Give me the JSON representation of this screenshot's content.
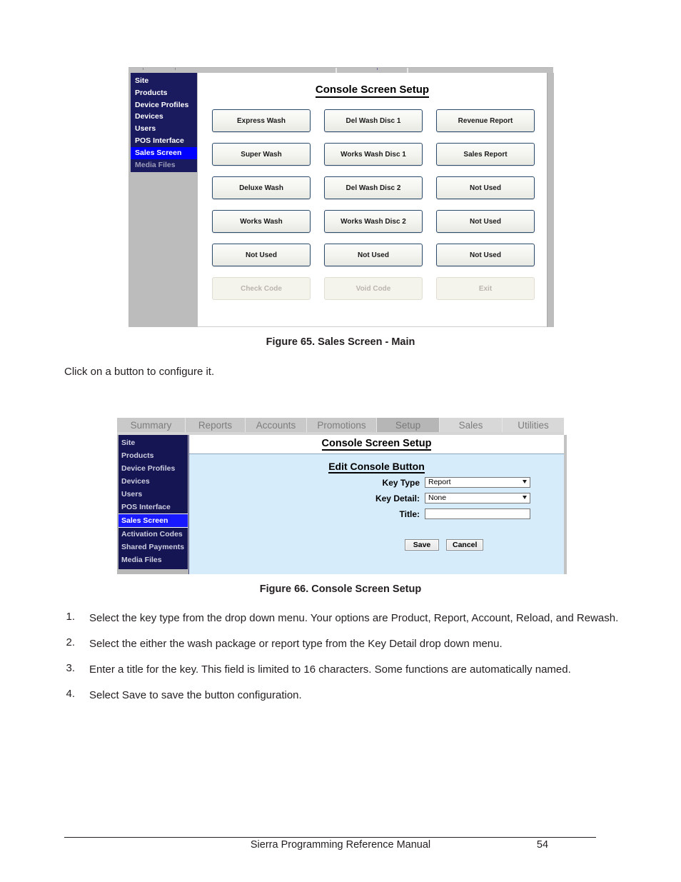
{
  "figure1": {
    "app_title": "Console Screen Setup",
    "sidebar": [
      {
        "label": "Site",
        "state": "normal"
      },
      {
        "label": "Products",
        "state": "normal"
      },
      {
        "label": "Device Profiles",
        "state": "normal"
      },
      {
        "label": "Devices",
        "state": "normal"
      },
      {
        "label": "Users",
        "state": "normal"
      },
      {
        "label": "POS Interface",
        "state": "normal"
      },
      {
        "label": "Sales Screen",
        "state": "selected"
      },
      {
        "label": "Media Files",
        "state": "dim"
      }
    ],
    "buttons": [
      {
        "label": "Express Wash",
        "state": "enabled"
      },
      {
        "label": "Del Wash Disc 1",
        "state": "enabled"
      },
      {
        "label": "Revenue Report",
        "state": "enabled"
      },
      {
        "label": "Super Wash",
        "state": "enabled"
      },
      {
        "label": "Works Wash Disc 1",
        "state": "enabled"
      },
      {
        "label": "Sales Report",
        "state": "enabled"
      },
      {
        "label": "Deluxe Wash",
        "state": "enabled"
      },
      {
        "label": "Del Wash Disc 2",
        "state": "enabled"
      },
      {
        "label": "Not Used",
        "state": "enabled"
      },
      {
        "label": "Works Wash",
        "state": "enabled"
      },
      {
        "label": "Works Wash Disc 2",
        "state": "enabled"
      },
      {
        "label": "Not Used",
        "state": "enabled"
      },
      {
        "label": "Not Used",
        "state": "enabled"
      },
      {
        "label": "Not Used",
        "state": "enabled"
      },
      {
        "label": "Not Used",
        "state": "enabled"
      },
      {
        "label": "Check Code",
        "state": "disabled"
      },
      {
        "label": "Void Code",
        "state": "disabled"
      },
      {
        "label": "Exit",
        "state": "disabled"
      }
    ],
    "caption": "Figure 65. Sales Screen - Main"
  },
  "intro_paragraph": "Click on a button to configure it.",
  "figure2": {
    "tabs": [
      {
        "label": "Summary",
        "active": false,
        "light": false
      },
      {
        "label": "Reports",
        "active": false,
        "light": false
      },
      {
        "label": "Accounts",
        "active": false,
        "light": false
      },
      {
        "label": "Promotions",
        "active": false,
        "light": false
      },
      {
        "label": "Setup",
        "active": true,
        "light": false
      },
      {
        "label": "Sales",
        "active": false,
        "light": true
      },
      {
        "label": "Utilities",
        "active": false,
        "light": true
      }
    ],
    "sidebar": [
      {
        "label": "Site",
        "state": "normal"
      },
      {
        "label": "Products",
        "state": "normal"
      },
      {
        "label": "Device Profiles",
        "state": "normal"
      },
      {
        "label": "Devices",
        "state": "normal"
      },
      {
        "label": "Users",
        "state": "normal"
      },
      {
        "label": "POS Interface",
        "state": "normal"
      },
      {
        "label": "Sales Screen",
        "state": "selected"
      },
      {
        "label": "Activation Codes",
        "state": "normal"
      },
      {
        "label": "Shared Payments",
        "state": "normal"
      },
      {
        "label": "Media Files",
        "state": "normal"
      }
    ],
    "page_header": "Console Screen Setup",
    "panel_title": "Edit Console Button",
    "form": {
      "key_type_label": "Key Type",
      "key_type_value": "Report",
      "key_detail_label": "Key Detail:",
      "key_detail_value": "None",
      "title_label": "Title:",
      "title_value": "",
      "title_placeholder": ""
    },
    "save_label": "Save",
    "cancel_label": "Cancel",
    "caption": "Figure 66. Console Screen Setup"
  },
  "steps": [
    {
      "num": "1.",
      "text": "Select the key type from the drop down menu. Your options are Product, Report, Account, Reload, and Rewash."
    },
    {
      "num": "2.",
      "text": "Select the either the wash package or report type from the Key Detail drop down menu."
    },
    {
      "num": "3.",
      "text": "Enter a title for the key. This field is limited to 16 characters. Some functions are automatically named."
    },
    {
      "num": "4.",
      "text": "Select Save to save the button configuration."
    }
  ],
  "footer": {
    "title": "Sierra Programming Reference Manual",
    "page": "54"
  }
}
